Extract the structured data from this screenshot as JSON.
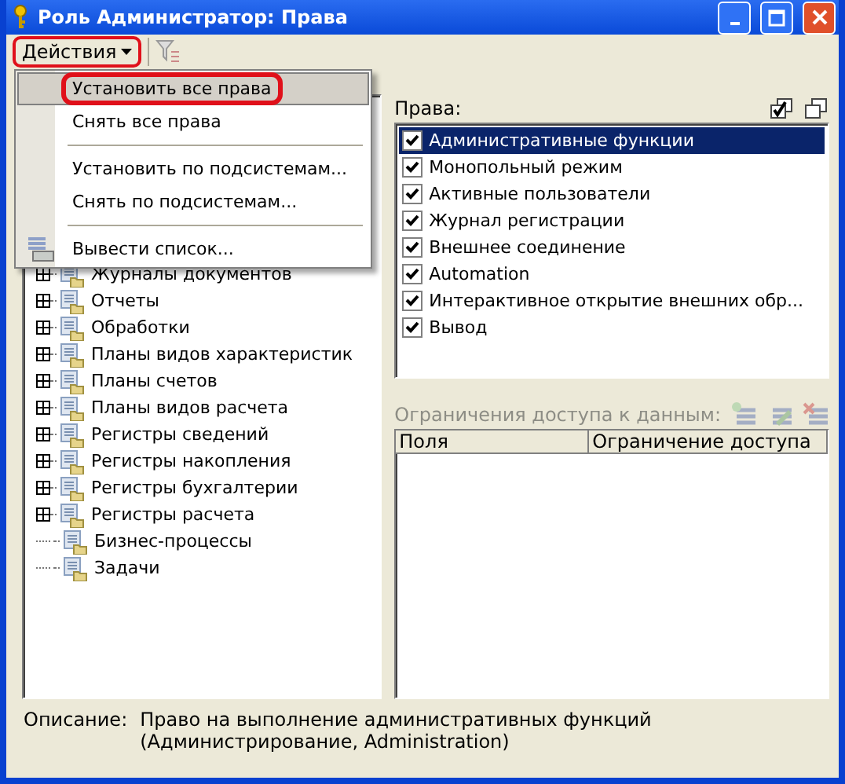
{
  "window": {
    "title": "Роль Администратор: Права"
  },
  "toolbar": {
    "actions_button": {
      "label": "Действия",
      "annotated": true
    }
  },
  "actions_menu": [
    {
      "kind": "item",
      "label": "Установить все права",
      "selected": true,
      "annotated": true
    },
    {
      "kind": "item",
      "label": "Снять все права",
      "selected": false,
      "annotated": false
    },
    {
      "kind": "separator"
    },
    {
      "kind": "item",
      "label": "Установить по подсистемам...",
      "selected": false,
      "annotated": false
    },
    {
      "kind": "item",
      "label": "Снять по подсистемам...",
      "selected": false,
      "annotated": false
    },
    {
      "kind": "separator"
    },
    {
      "kind": "item",
      "label": "Вывести список...",
      "selected": false,
      "annotated": false,
      "icon": true
    }
  ],
  "tree": [
    {
      "label": "Журналы документов",
      "expandable": true
    },
    {
      "label": "Отчеты",
      "expandable": true
    },
    {
      "label": "Обработки",
      "expandable": true
    },
    {
      "label": "Планы видов характеристик",
      "expandable": true
    },
    {
      "label": "Планы счетов",
      "expandable": true
    },
    {
      "label": "Планы видов расчета",
      "expandable": true
    },
    {
      "label": "Регистры сведений",
      "expandable": true
    },
    {
      "label": "Регистры накопления",
      "expandable": true
    },
    {
      "label": "Регистры бухгалтерии",
      "expandable": true
    },
    {
      "label": "Регистры расчета",
      "expandable": true
    },
    {
      "label": "Бизнес-процессы",
      "expandable": false
    },
    {
      "label": "Задачи",
      "expandable": false
    }
  ],
  "rights": {
    "label": "Права:",
    "items": [
      {
        "label": "Административные функции",
        "checked": true,
        "selected": true
      },
      {
        "label": "Монопольный режим",
        "checked": true,
        "selected": false
      },
      {
        "label": "Активные пользователи",
        "checked": true,
        "selected": false
      },
      {
        "label": "Журнал регистрации",
        "checked": true,
        "selected": false
      },
      {
        "label": "Внешнее соединение",
        "checked": true,
        "selected": false
      },
      {
        "label": "Automation",
        "checked": true,
        "selected": false
      },
      {
        "label": "Интерактивное открытие внешних обр...",
        "checked": true,
        "selected": false
      },
      {
        "label": "Вывод",
        "checked": true,
        "selected": false
      }
    ]
  },
  "restrictions": {
    "label": "Ограничения доступа к данным:",
    "disabled": true,
    "columns": [
      "Поля",
      "Ограничение доступа"
    ]
  },
  "description": {
    "label": "Описание:",
    "lines": [
      "Право на выполнение административных функций",
      "(Администрирование, Administration)"
    ]
  }
}
